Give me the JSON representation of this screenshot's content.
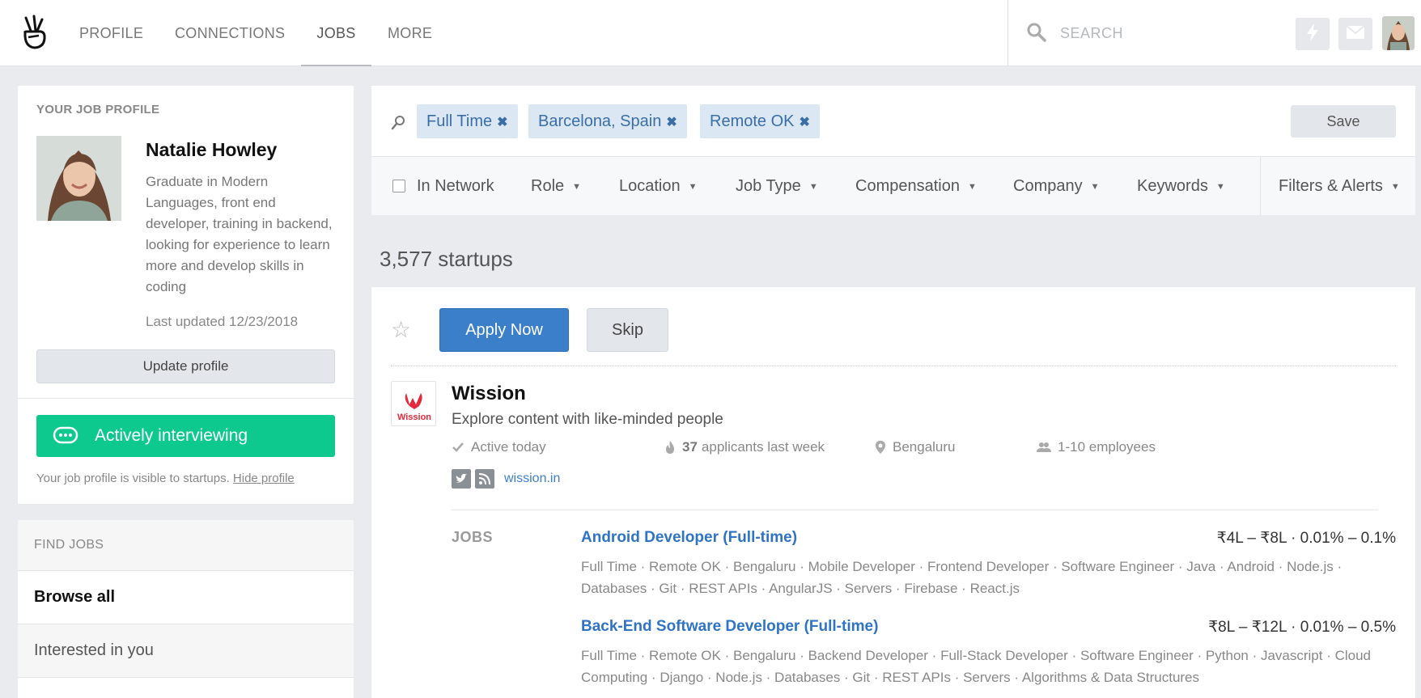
{
  "nav": {
    "links": [
      "PROFILE",
      "CONNECTIONS",
      "JOBS",
      "MORE"
    ],
    "search_placeholder": "SEARCH"
  },
  "sidebar": {
    "job_profile_title": "YOUR JOB PROFILE",
    "name": "Natalie Howley",
    "bio": "Graduate in Modern Languages, front end developer, training in backend, looking for experience to learn more and develop skills in coding",
    "last_updated": "Last updated 12/23/2018",
    "update_button": "Update profile",
    "status_button": "Actively interviewing",
    "visibility_note": "Your job profile is visible to startups.",
    "hide_link": "Hide profile",
    "find_jobs_title": "FIND JOBS",
    "find_jobs_items": [
      "Browse all",
      "Interested in you"
    ]
  },
  "filters": {
    "tags": [
      "Full Time",
      "Barcelona, Spain",
      "Remote OK"
    ],
    "remove_glyph": "✖",
    "save_label": "Save",
    "in_network": "In Network",
    "dropdowns": [
      "Role",
      "Location",
      "Job Type",
      "Compensation",
      "Company",
      "Keywords"
    ],
    "filters_alerts": "Filters & Alerts"
  },
  "results": {
    "count": "3,577 startups"
  },
  "startup": {
    "apply_label": "Apply Now",
    "skip_label": "Skip",
    "star_glyph": "☆",
    "name": "Wission",
    "tagline": "Explore content with like-minded people",
    "logo_text": "Wission",
    "active": "Active today",
    "applicants_count": "37",
    "applicants_label": "applicants last week",
    "location": "Bengaluru",
    "employees": "1-10 employees",
    "website": "wission.in",
    "jobs_label": "JOBS",
    "jobs": [
      {
        "title": "Android Developer (Full-time)",
        "compensation": "₹4L – ₹8L · 0.01% – 0.1%",
        "tags": "Full Time · Remote OK · Bengaluru · Mobile Developer · Frontend Developer · Software Engineer · Java · Android · Node.js · Databases · Git · REST APIs · AngularJS · Servers · Firebase · React.js"
      },
      {
        "title": "Back-End Software Developer (Full-time)",
        "compensation": "₹8L – ₹12L · 0.01% – 0.5%",
        "tags": "Full Time · Remote OK · Bengaluru · Backend Developer · Full-Stack Developer · Software Engineer · Python · Javascript · Cloud Computing · Django · Node.js · Databases · Git · REST APIs · Servers · Algorithms & Data Structures"
      }
    ]
  },
  "colors": {
    "accent_blue": "#3b7fcb",
    "interview_green": "#0ec98d",
    "tag_bg": "#dbe8f3",
    "brand_red": "#e5283b"
  },
  "icons": [
    "victory-hand-logo-icon",
    "search-icon",
    "lightning-icon",
    "mail-icon",
    "chat-bubble-icon",
    "check-icon",
    "flame-icon",
    "location-pin-icon",
    "people-icon",
    "twitter-icon",
    "rss-icon",
    "star-icon"
  ]
}
